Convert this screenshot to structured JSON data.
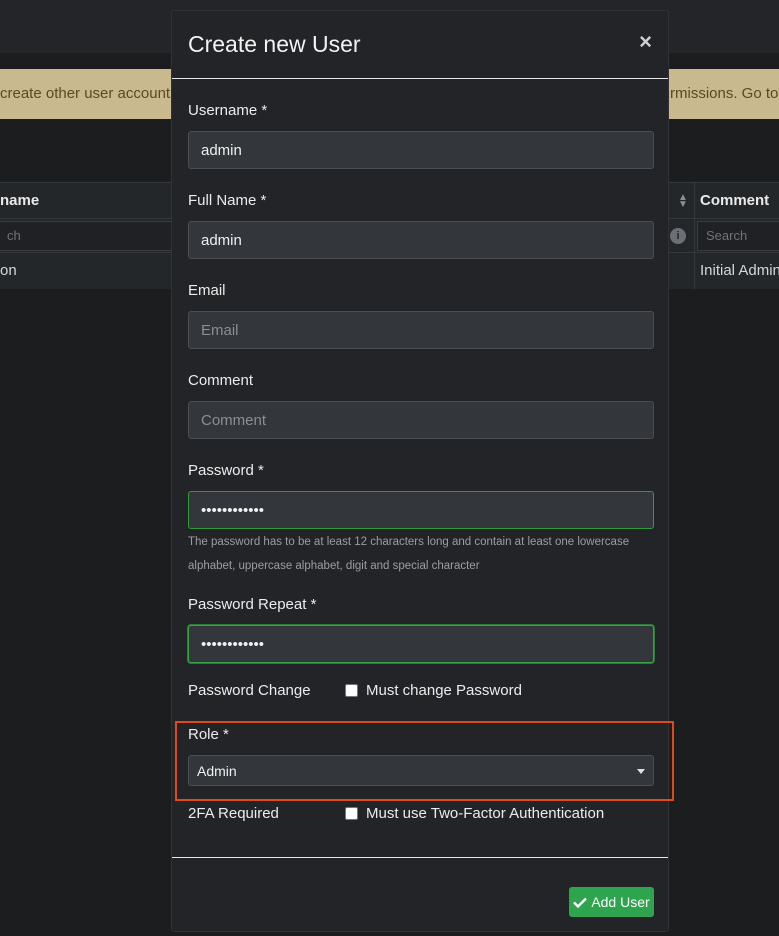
{
  "background": {
    "banner": {
      "left_text": "create other user accounts",
      "right_text": "rmissions. Go to $"
    },
    "table": {
      "headers": {
        "name": "name",
        "comment": "Comment"
      },
      "filters": {
        "name": "ch",
        "comment": "Search"
      },
      "row": {
        "name": "on",
        "comment": "Initial Admin"
      }
    }
  },
  "modal": {
    "title": "Create new User",
    "close": "×",
    "fields": {
      "username": {
        "label": "Username *",
        "value": "admin"
      },
      "fullname": {
        "label": "Full Name *",
        "value": "admin"
      },
      "email": {
        "label": "Email",
        "placeholder": "Email"
      },
      "comment": {
        "label": "Comment",
        "placeholder": "Comment"
      },
      "password": {
        "label": "Password *",
        "value": "••••••••••••",
        "help_line1": "The password has to be at least 12 characters long and contain at least one lowercase",
        "help_line2": "alphabet, uppercase alphabet, digit and special character"
      },
      "password_repeat": {
        "label": "Password Repeat *",
        "value": "••••••••••••"
      },
      "password_change": {
        "label": "Password Change",
        "checkbox_label": "Must change Password"
      },
      "role": {
        "label": "Role *",
        "selected": "Admin"
      },
      "twofa": {
        "label": "2FA Required",
        "checkbox_label": "Must use Two-Factor Authentication"
      }
    },
    "add_button": "Add User"
  },
  "colors": {
    "accent_green": "#2ea44f",
    "highlight_border": "#e04a17",
    "banner_bg": "#c9b98e"
  }
}
